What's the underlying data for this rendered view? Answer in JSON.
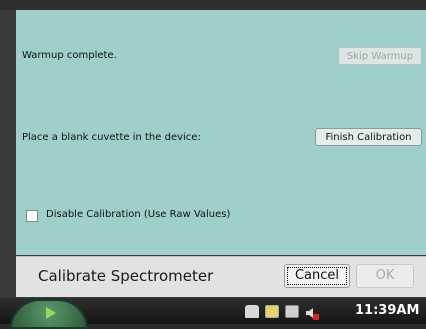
{
  "dialog": {
    "warmup_text": "Warmup complete.",
    "skip_warmup_label": "Skip Warmup",
    "blank_text": "Place a blank cuvette in the device:",
    "finish_label": "Finish Calibration",
    "disable_label": "Disable Calibration (Use Raw Values)",
    "disable_checked": false
  },
  "footer": {
    "title": "Calibrate Spectrometer",
    "cancel_label": "Cancel",
    "ok_label": "OK"
  },
  "taskbar": {
    "time": "11:39AM",
    "tray_icons": [
      "home-icon",
      "calendar-icon",
      "keyboard-icon",
      "volume-muted-icon"
    ]
  },
  "colors": {
    "content_bg": "#9ecfcb",
    "footer_bg": "#e2e2e2",
    "taskbar_bg": "#1e1e1e"
  }
}
